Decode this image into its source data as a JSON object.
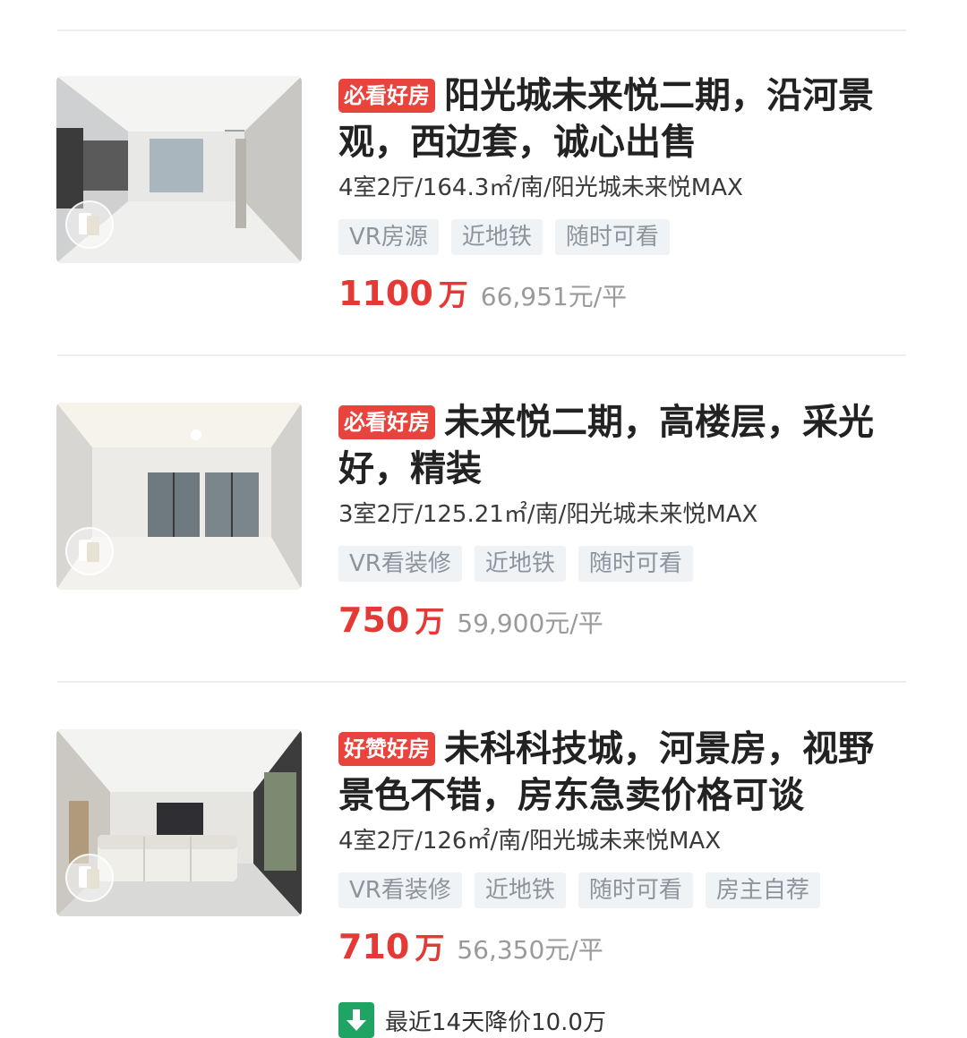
{
  "listings": [
    {
      "badge": "必看好房",
      "title": "阳光城未来悦二期，沿河景观，西边套，诚心出售",
      "specs": "4室2厅/164.3㎡/南/阳光城未来悦MAX",
      "tags": [
        "VR房源",
        "近地铁",
        "随时可看"
      ],
      "price": "1100",
      "price_unit": "万",
      "unit_price": "66,951元/平"
    },
    {
      "badge": "必看好房",
      "title": "未来悦二期，高楼层，采光好，精装",
      "specs": "3室2厅/125.21㎡/南/阳光城未来悦MAX",
      "tags": [
        "VR看装修",
        "近地铁",
        "随时可看"
      ],
      "price": "750",
      "price_unit": "万",
      "unit_price": "59,900元/平"
    },
    {
      "badge": "好赞好房",
      "title": "未科科技城，河景房，视野景色不错，房东急卖价格可谈",
      "specs": "4室2厅/126㎡/南/阳光城未来悦MAX",
      "tags": [
        "VR看装修",
        "近地铁",
        "随时可看",
        "房主自荐"
      ],
      "price": "710",
      "price_unit": "万",
      "unit_price": "56,350元/平",
      "price_drop": "最近14天降价10.0万"
    }
  ],
  "colors": {
    "badge": "#e9433d",
    "price": "#e53935",
    "tag_bg": "#f0f3f6",
    "tag_text": "#8c949c",
    "drop_icon": "#1fa463"
  },
  "icons": {
    "thumbnail_overlay": "vr-panorama-icon",
    "price_drop": "arrow-down-icon"
  }
}
